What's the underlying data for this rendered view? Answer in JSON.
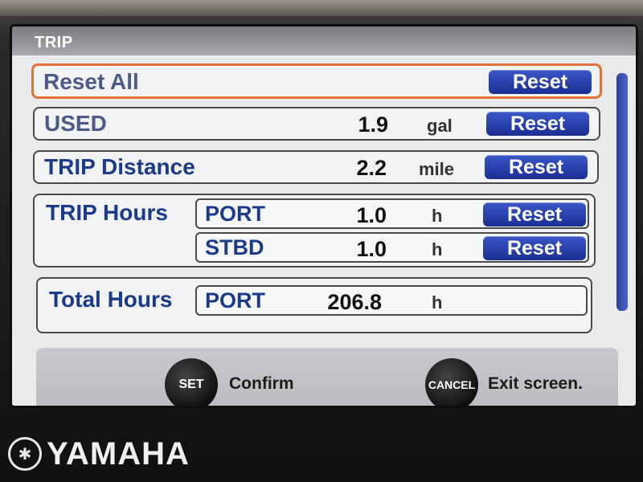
{
  "screen": {
    "title": "TRIP"
  },
  "rows": {
    "reset_all": {
      "label": "Reset All",
      "button": "Reset"
    },
    "used": {
      "label": "USED",
      "value": "1.9",
      "unit": "gal",
      "button": "Reset"
    },
    "trip_distance": {
      "label": "TRIP Distance",
      "value": "2.2",
      "unit": "mile",
      "button": "Reset"
    },
    "trip_hours": {
      "label": "TRIP Hours",
      "port": {
        "label": "PORT",
        "value": "1.0",
        "unit": "h",
        "button": "Reset"
      },
      "stbd": {
        "label": "STBD",
        "value": "1.0",
        "unit": "h",
        "button": "Reset"
      }
    },
    "total_hours": {
      "label": "Total Hours",
      "port": {
        "label": "PORT",
        "value": "206.8",
        "unit": "h"
      }
    }
  },
  "footer": {
    "set_button": "SET",
    "set_label": "Confirm",
    "cancel_button": "CANCEL",
    "cancel_label": "Exit screen."
  },
  "brand": {
    "name": "YAMAHA",
    "icon": "tuning-fork-emblem"
  },
  "colors": {
    "selection_border": "#e4703a",
    "reset_button": "#2a42b0",
    "label_text": "#1b3a8a"
  }
}
